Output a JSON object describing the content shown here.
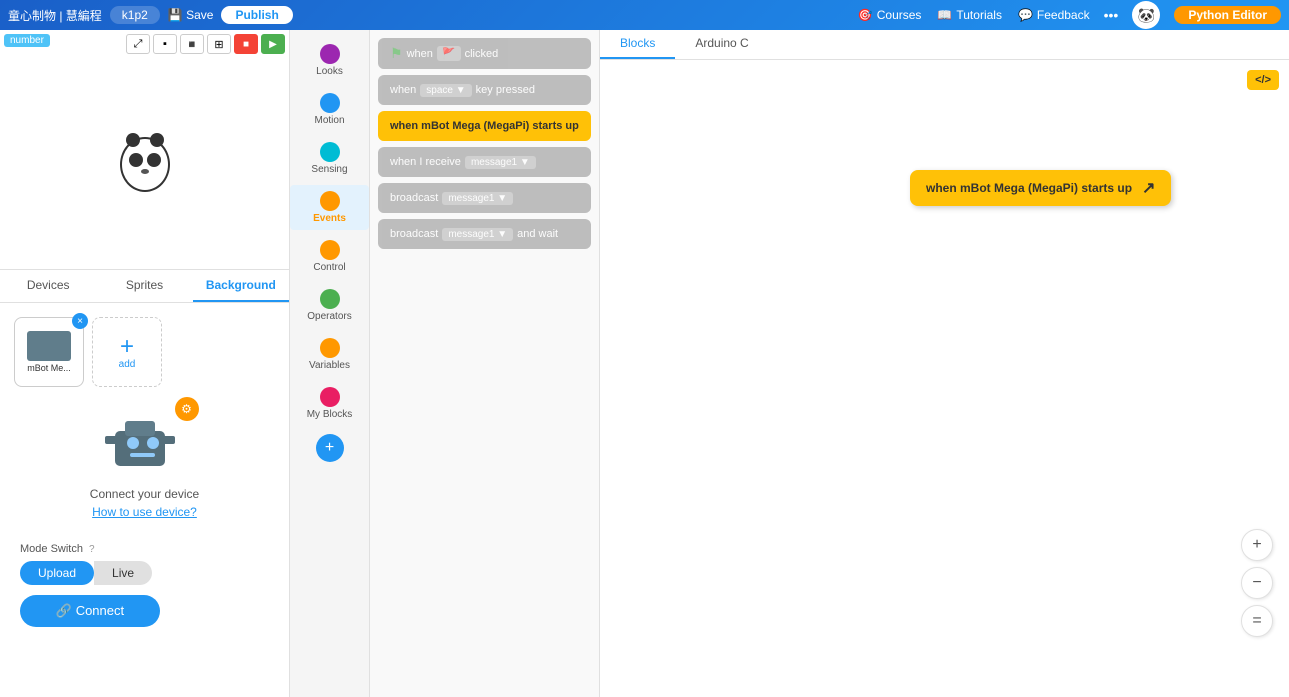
{
  "nav": {
    "brand": "童心制物 | 慧編程",
    "project_name": "k1p2",
    "save_label": "💾 Save",
    "publish_label": "Publish",
    "courses_label": "Courses",
    "tutorials_label": "Tutorials",
    "feedback_label": "Feedback",
    "more_label": "•••",
    "python_editor_label": "Python Editor"
  },
  "tabs": {
    "devices_label": "Devices",
    "sprites_label": "Sprites",
    "background_label": "Background"
  },
  "left_panel": {
    "number_badge": "number",
    "panda_alt": "panda sprite",
    "connect_label": "Connect your device",
    "how_to_link": "How to use device?",
    "mode_switch_label": "Mode Switch",
    "upload_label": "Upload",
    "live_label": "Live",
    "connect_btn_label": "🔗 Connect",
    "add_label": "add",
    "device_name": "mBot Me..."
  },
  "categories": [
    {
      "id": "looks",
      "label": "Looks",
      "color": "#9c27b0"
    },
    {
      "id": "motion",
      "label": "Motion",
      "color": "#2196f3"
    },
    {
      "id": "sensing",
      "label": "Sensing",
      "color": "#00bcd4"
    },
    {
      "id": "events",
      "label": "Events",
      "color": "#ff9800",
      "active": true
    },
    {
      "id": "control",
      "label": "Control",
      "color": "#ff9800"
    },
    {
      "id": "operators",
      "label": "Operators",
      "color": "#4caf50"
    },
    {
      "id": "variables",
      "label": "Variables",
      "color": "#ff9800"
    },
    {
      "id": "my_blocks",
      "label": "My Blocks",
      "color": "#e91e63"
    }
  ],
  "blocks": [
    {
      "id": "when_clicked",
      "type": "muted",
      "text": "when 🚩 clicked"
    },
    {
      "id": "when_space_pressed",
      "type": "muted",
      "text": "when [ space ▼ ] key pressed"
    },
    {
      "id": "when_mbot_starts",
      "type": "yellow",
      "text": "when mBot Mega (MegaPi) starts up"
    },
    {
      "id": "when_receive",
      "type": "muted",
      "text": "when I receive [ message1 ▼ ]"
    },
    {
      "id": "broadcast",
      "type": "muted",
      "text": "broadcast [ message1 ▼ ]"
    },
    {
      "id": "broadcast_wait",
      "type": "muted",
      "text": "broadcast [ message1 ▼ ] and wait"
    }
  ],
  "canvas": {
    "blocks_tab": "Blocks",
    "arduino_tab": "Arduino C",
    "canvas_block_text": "when mBot Mega (MegaPi) starts up",
    "xml_label": "</>"
  },
  "zoom": {
    "zoom_in_icon": "+",
    "zoom_out_icon": "−",
    "fit_icon": "="
  }
}
